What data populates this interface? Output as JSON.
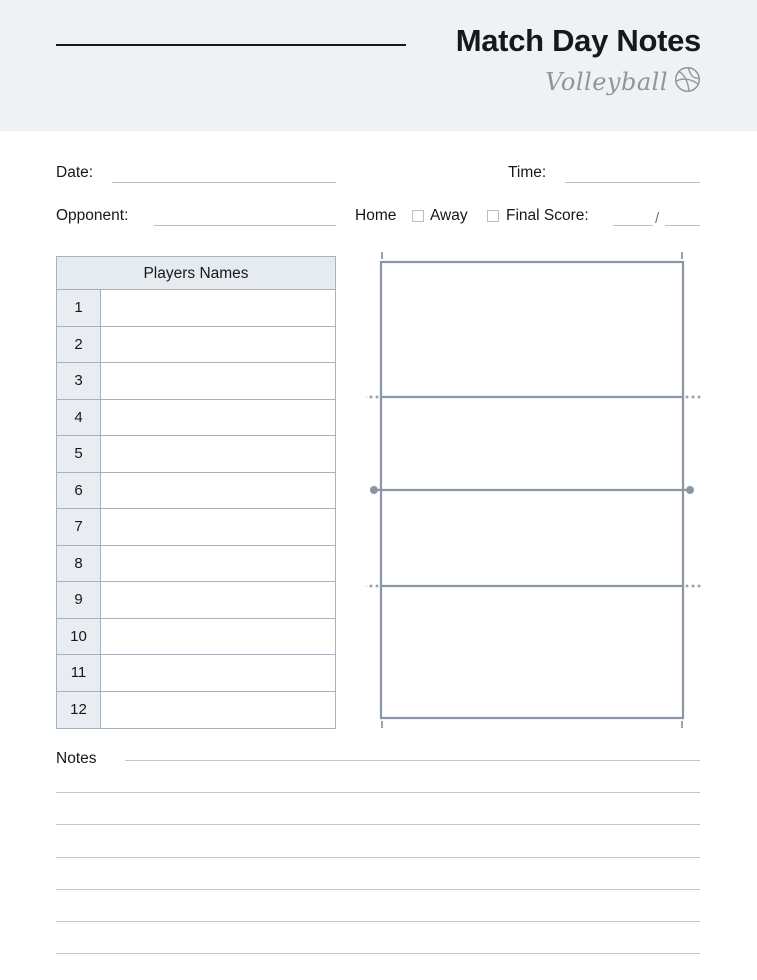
{
  "header": {
    "title": "Match Day Notes",
    "subtitle": "Volleyball",
    "ball_icon": "volleyball-icon",
    "band_color": "#eef2f5",
    "title_color": "#15181c",
    "subtitle_color": "#8e959d"
  },
  "fields": {
    "date_label": "Date:",
    "time_label": "Time:",
    "opponent_label": "Opponent:",
    "home_label": "Home",
    "away_label": "Away",
    "final_score_label": "Final Score:",
    "score_separator": "/",
    "date_value": "",
    "time_value": "",
    "opponent_value": "",
    "home_checked": false,
    "away_checked": false,
    "score_home_value": "",
    "score_away_value": ""
  },
  "players": {
    "header": "Players Names",
    "rows": [
      {
        "number": "1",
        "name": ""
      },
      {
        "number": "2",
        "name": ""
      },
      {
        "number": "3",
        "name": ""
      },
      {
        "number": "4",
        "name": ""
      },
      {
        "number": "5",
        "name": ""
      },
      {
        "number": "6",
        "name": ""
      },
      {
        "number": "7",
        "name": ""
      },
      {
        "number": "8",
        "name": ""
      },
      {
        "number": "9",
        "name": ""
      },
      {
        "number": "10",
        "name": ""
      },
      {
        "number": "11",
        "name": ""
      },
      {
        "number": "12",
        "name": ""
      }
    ],
    "header_fill": "#e6ebef",
    "number_fill": "#e9edf1",
    "border_color": "#a8b2bc"
  },
  "court": {
    "name": "volleyball-court-diagram",
    "line_color": "#8a96a3",
    "net_line_label": "center-net-line",
    "attack_line_label": "attack-line",
    "post_marker_label": "net-post-marker",
    "tick_marker_label": "service-zone-tick"
  },
  "notes": {
    "label": "Notes",
    "line_count": 7,
    "line_color": "#c3c8ce",
    "lines": [
      "",
      "",
      "",
      "",
      "",
      "",
      ""
    ]
  }
}
